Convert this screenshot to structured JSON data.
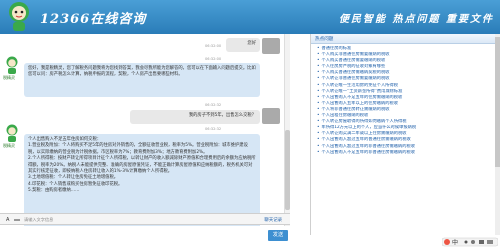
{
  "header": {
    "title": "12366在线咨询",
    "slogan": "便民智能  热点问题  重要文件"
  },
  "chat": {
    "bot_name": "税精灵",
    "msg1": {
      "time": "06:32:00",
      "text": "您好"
    },
    "msg2": {
      "time": "06:32:00",
      "text": "您好，我是税精灵，您了解税务问题我将为您找到答案，我会尽我所能为您解答的，您可以在下面输入问题后提交。比如您可以问：房产税怎么计算，纳税申报的流程，契税，个人房产出售要哪些材料。"
    },
    "msg3": {
      "time": "06:32:32",
      "text": "我的房子不到5年，出售怎么交税？"
    },
    "msg4": {
      "time": "06:32:32",
      "text": "个人出售购入不足五年住房如何交税：\n1.营业税及附加：个人将购买不足5年的住房对外销售的，全额征收营业税，税率为5%。营业税附加：城市维护建设税，以实际缴纳的营业税为计税依据，市区税率为7%；教育费附加3%；地方教育费附加2%。\n2.个人所得税：按财产转让所得项目计征个人所得税，以转让财产的收入额减除财产原值和合理费用后的余额为应纳税所得额，税率为20%。纳税人未能提供完整、准确的房屋原值凭证，不能正确计算房屋原值和应纳税额的，税务机关可对其实行核定征收，即按纳税人住房转让收入的1%-3%计算缴纳个人所得税。\n3.土地增值税：个人转让住房免征土地增值税。\n4.印花税：个人销售或购买住房暂免征收印花税。\n5.契税：由购房者缴纳……"
    }
  },
  "input": {
    "hint": "请输入文字信息",
    "history_label": "聊天记录",
    "send_label": "发送"
  },
  "panel": {
    "tab_label": "热点问题",
    "items": [
      "普通住房的标准",
      "个人购买非普通住房需要缴纳的税收",
      "个人购买普通住房需要缴纳的税收",
      "个人住房房产税的征收对象有哪些",
      "个人购买普通住房需缴纳契税的税收",
      "个人转让非普通住房需要缴纳的税收",
      "个人转让唯一生活用房的免征个人所得税",
      "个人转让唯一“工资薪金所得”费用减除标准",
      "个人出售购入不足五年的住房需缴纳的税收",
      "个人出售购入五年以上的住房缴纳的税收",
      "个人将非普通住房转让需缴纳的税收",
      "个人出租住房缴纳的税收",
      "个人转让房屋取得的所得如何缴纳个人所得税",
      "年所得12万元以上的个人，应当什么时候申报纳税",
      "个人转让购买满二年或以上住房需缴纳的税收",
      "个人出售购入超过五年的普通住房需缴纳的税收",
      "个人出售购入超过五年的非普通住房需缴纳的税收",
      "个人出售购入不足五年的非普通住房需缴纳的税收"
    ]
  },
  "colors": {
    "header": "#2a7cb8",
    "bubble_bot": "#d6e6f5",
    "bubble_user": "#e8e8e8",
    "link": "#1a5ca8",
    "send": "#3d8fd1"
  },
  "icons": {
    "logo": "mascot-icon",
    "user": "user-avatar-icon",
    "font": "font-size-icon",
    "tray": "ime-toolbar-icon"
  }
}
